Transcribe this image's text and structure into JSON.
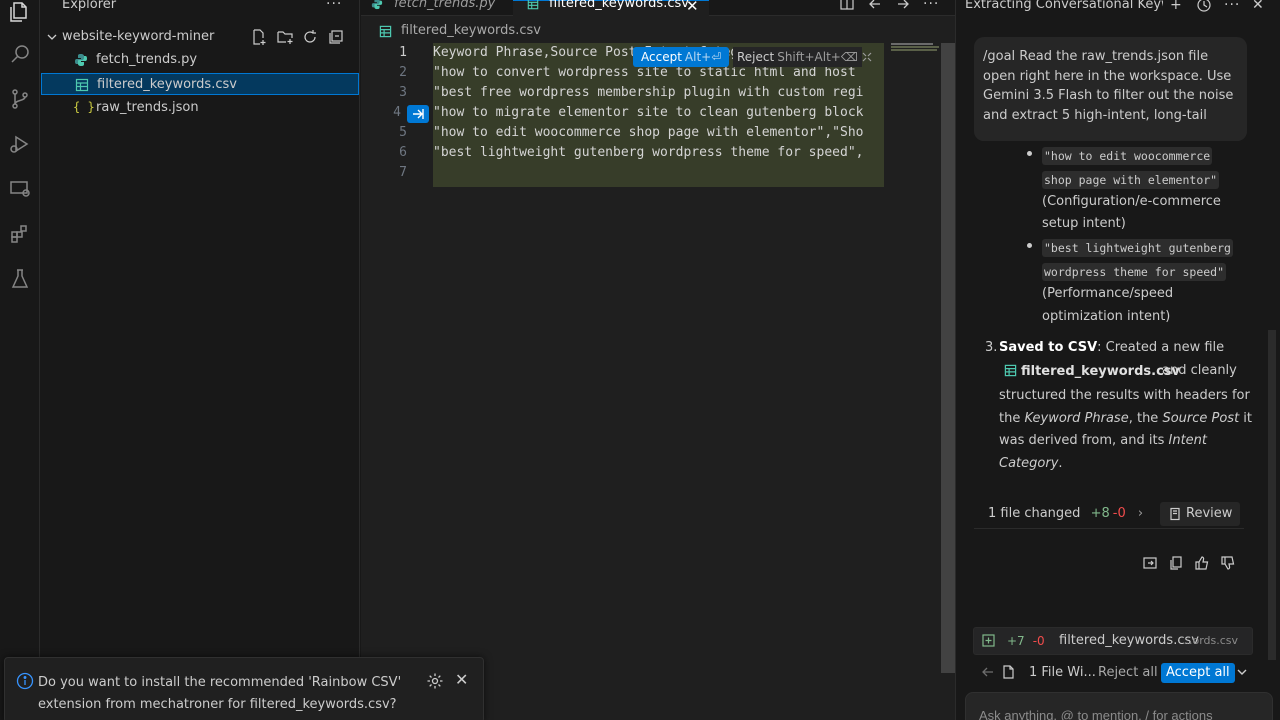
{
  "activity_bar": {
    "icons": [
      "explorer-icon",
      "search-icon",
      "source-control-icon",
      "run-debug-icon",
      "remote-explorer-icon",
      "extensions-icon",
      "testing-icon"
    ]
  },
  "explorer": {
    "title": "Explorer",
    "more": "···",
    "folder": "website-keyword-miner",
    "files": [
      {
        "name": "fetch_trends.py",
        "icon": "python-icon"
      },
      {
        "name": "filtered_keywords.csv",
        "icon": "csv-icon",
        "selected": true
      },
      {
        "name": "raw_trends.json",
        "icon": "json-icon"
      }
    ],
    "json_glyph": "{ }"
  },
  "editor": {
    "tabs": [
      {
        "label": "fetch_trends.py",
        "italic": true
      },
      {
        "label": "filtered_keywords.csv",
        "active": true
      }
    ],
    "tab_close": "✕",
    "breadcrumb": "filtered_keywords.csv",
    "line_numbers": [
      "1",
      "2",
      "3",
      "4",
      "5",
      "6",
      "7"
    ],
    "lines": [
      "Keyword Phrase,Source Post,Intent Category",
      "\"how to convert wordpress site to static html and host",
      "\"best free wordpress membership plugin with custom regi",
      "\"how to migrate elementor site to clean gutenberg block",
      "\"how to edit woocommerce shop page with elementor\",\"Sho",
      "\"best lightweight gutenberg wordpress theme for speed\",",
      ""
    ],
    "accept_label": "Accept",
    "accept_kbd": "Alt+⏎",
    "reject_label": "Reject",
    "reject_kbd": "Shift+Alt+⌫"
  },
  "notification": {
    "text": "Do you want to install the recommended 'Rainbow CSV' extension from mechatroner for filtered_keywords.csv?",
    "close": "✕"
  },
  "chat": {
    "title": "Extracting Conversational Keywords",
    "header_plus": "+",
    "header_close": "✕",
    "user_message": "/goal Read the raw_trends.json file open right here in the workspace. Use Gemini 3.5 Flash to filter out the noise and extract 5 high-intent, long-tail",
    "bullets": [
      {
        "chip_1": "\"how to edit woocommerce",
        "chip_2": "shop page with elementor\"",
        "desc_1": "(Configuration/e-commerce",
        "desc_2": "setup intent)"
      },
      {
        "chip_1": "\"best lightweight gutenberg",
        "chip_2": "wordpress theme for speed\"",
        "desc_1": "(Performance/speed",
        "desc_2": "optimization intent)"
      }
    ],
    "step3": {
      "number": "3.",
      "bold": "Saved to CSV",
      "text_1": ": Created a new file",
      "file": "filtered_keywords.csv",
      "text_2": "and cleanly",
      "line_3": "structured the results with headers for",
      "line_4_a": "the ",
      "line_4_kp": "Keyword Phrase",
      "line_4_b": ", the ",
      "line_4_sp": "Source Post",
      "line_4_c": " it",
      "line_5_a": "was derived from, and its ",
      "line_5_ic": "Intent",
      "line_6_ic": "Category",
      "line_6_b": "."
    },
    "changed": {
      "label": "1 file changed",
      "plus": "+8",
      "minus": "-0",
      "review": "Review"
    },
    "edit_row": {
      "plus": "+7",
      "minus": "-0",
      "name": "filtered_keywords.csv",
      "desc": "...ords.csv"
    },
    "files_row": {
      "label": "1 File Wi...",
      "reject_all": "Reject all",
      "accept_all": "Accept all"
    },
    "input_placeholder": "Ask anything, @ to mention, / for actions"
  },
  "colors": {
    "accent": "#0078d4",
    "added_line_bg": "#373d29",
    "selected_row": "#04395e"
  }
}
